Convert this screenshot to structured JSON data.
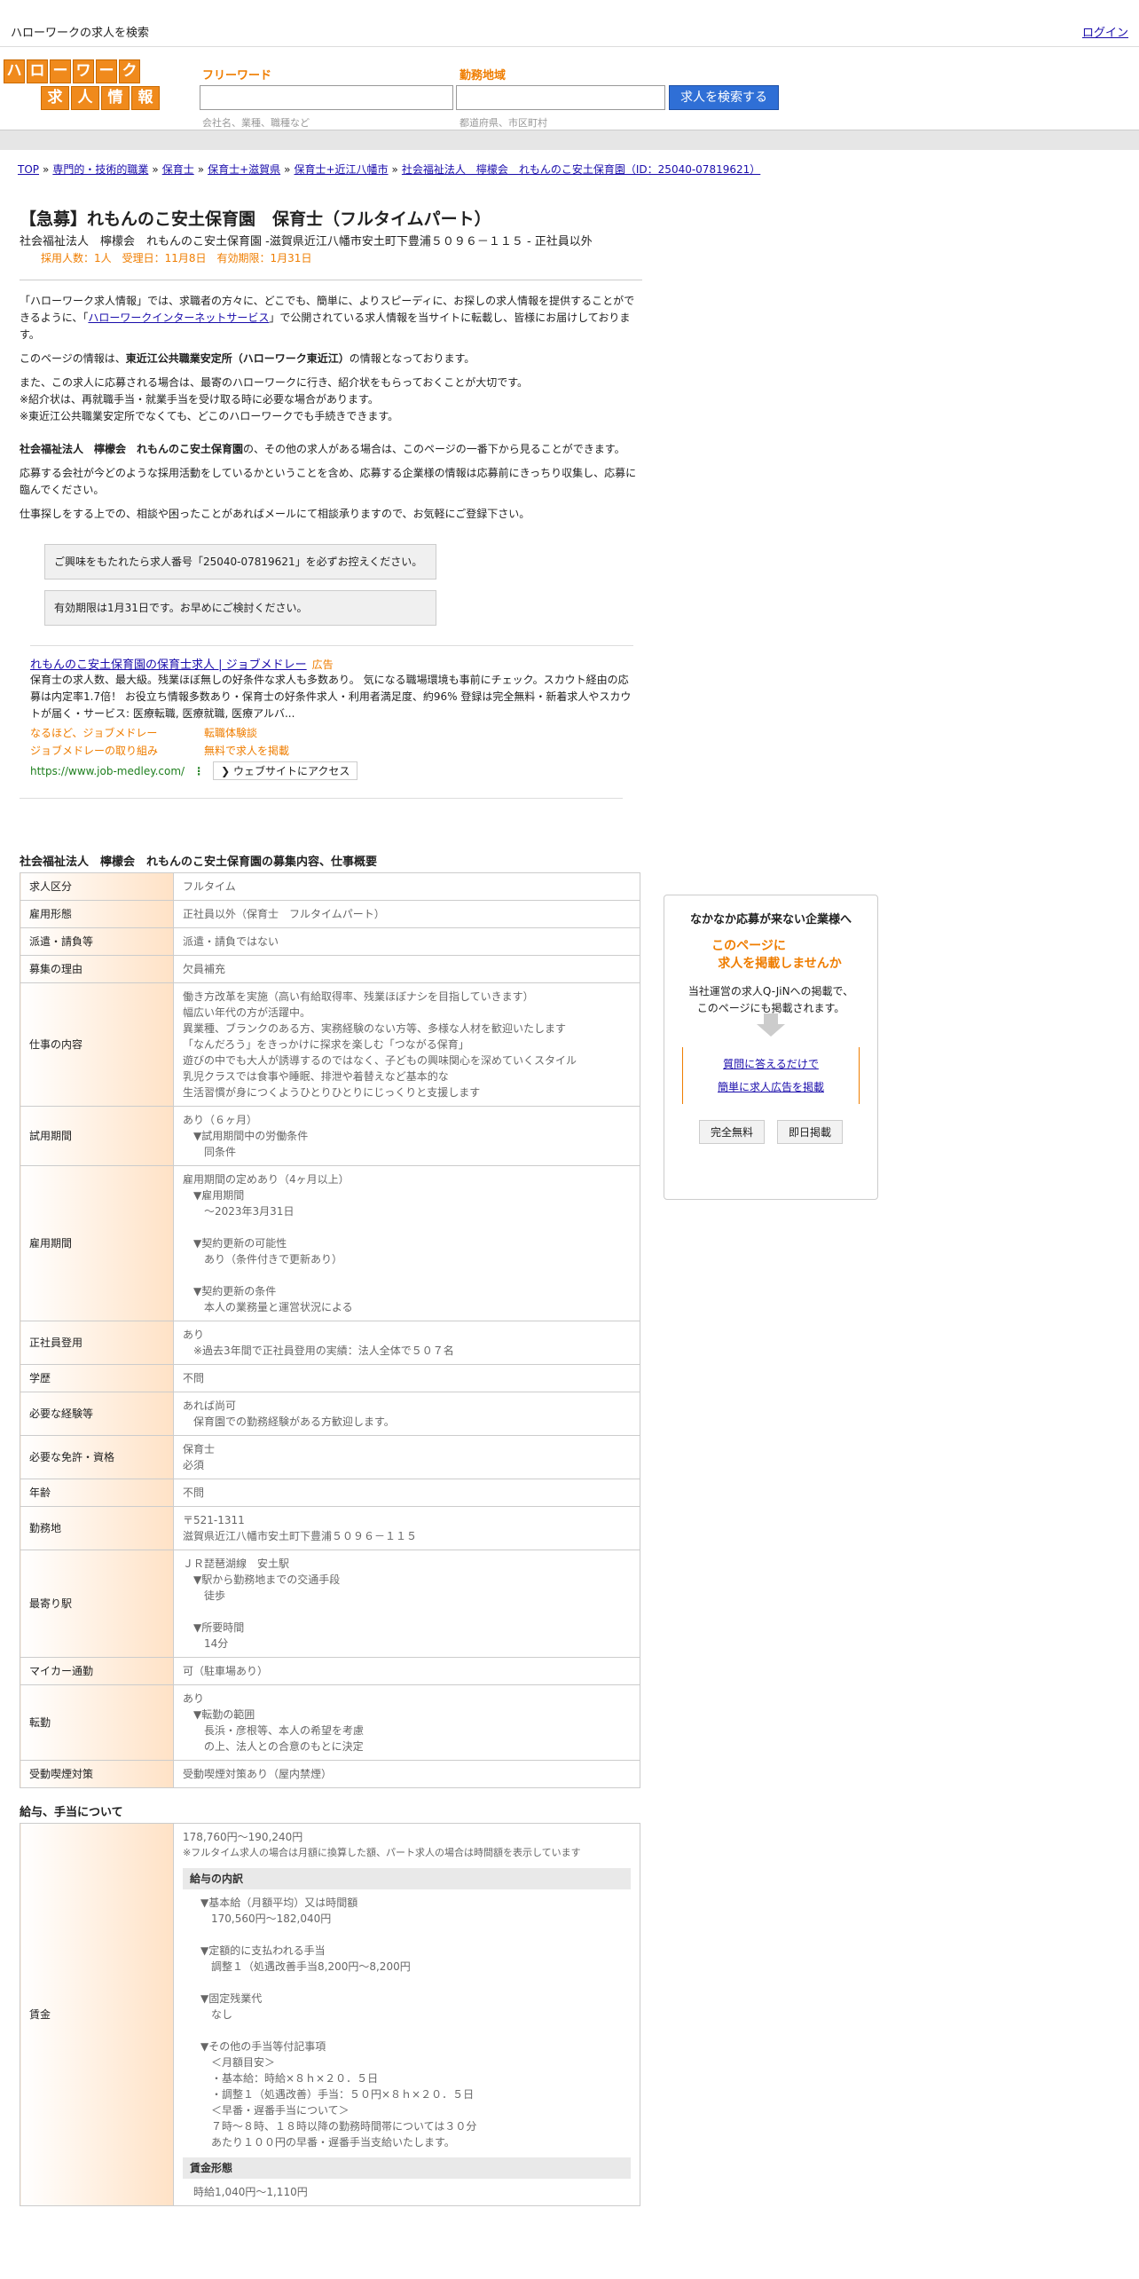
{
  "topbar": {
    "site_title": "ハローワークの求人を検索",
    "login": "ログイン"
  },
  "logo": {
    "row1": [
      "ハ",
      "ロ",
      "ー",
      "ワ",
      "ー",
      "ク"
    ],
    "row2": [
      "求",
      "人",
      "情",
      "報"
    ]
  },
  "search": {
    "freeword_label": "フリーワード",
    "freeword_hint": "会社名、業種、職種など",
    "area_label": "勤務地域",
    "area_hint": "都道府県、市区町村",
    "button": "求人を検索する"
  },
  "breadcrumb": [
    "TOP",
    "専門的・技術的職業",
    "保育士",
    "保育士+滋賀県",
    "保育士+近江八幡市",
    "社会福祉法人　檸檬会　れもんのこ安土保育園（ID：25040-07819621）"
  ],
  "job": {
    "title": "【急募】れもんのこ安土保育園　保育士（フルタイムパート）",
    "subtitle": "社会福祉法人　檸檬会　れもんのこ安土保育園 -滋賀県近江八幡市安土町下豊浦５０９６－１１５ - 正社員以外",
    "meta": "採用人数：1人　受理日：11月8日　有効期限：1月31日"
  },
  "intro": {
    "p1a": "「ハローワーク求人情報」では、求職者の方々に、どこでも、簡単に、よりスピーディに、お探しの求人情報を提供することができるように、「",
    "p1link": "ハローワークインターネットサービス",
    "p1b": "」で公開されている求人情報を当サイトに転載し、皆様にお届けしております。",
    "p2a": "このページの情報は、",
    "p2b": "東近江公共職業安定所（ハローワーク東近江）",
    "p2c": "の情報となっております。",
    "p3": [
      "また、この求人に応募される場合は、最寄のハローワークに行き、紹介状をもらっておくことが大切です。",
      "※紹介状は、再就職手当・就業手当を受け取る時に必要な場合があります。",
      "※東近江公共職業安定所でなくても、どこのハローワークでも手続きできます。"
    ],
    "p4a": "社会福祉法人　檸檬会　れもんのこ安土保育園",
    "p4b": "の、その他の求人がある場合は、このページの一番下から見ることができます。",
    "p5": "応募する会社が今どのような採用活動をしているかということを含め、応募する企業様の情報は応募前にきっちり収集し、応募に臨んでください。",
    "p6": "仕事探しをする上での、相談や困ったことがあればメールにて相談承りますので、お気軽にご登録下さい。",
    "note1": "ご興味をもたれたら求人番号「25040-07819621」を必ずお控えください。",
    "note2": "有効期限は1月31日です。お早めにご検討ください。"
  },
  "ad": {
    "title": "れもんのこ安土保育園の保育士求人 | ジョブメドレー",
    "badge": "広告",
    "body": "保育士の求人数、最大級。残業ほぼ無しの好条件な求人も多数あり。 気になる職場環境も事前にチェック。スカウト経由の応募は内定率1.7倍！ お役立ち情報多数あり・保育士の好条件求人・利用者満足度、約96% 登録は完全無料・新着求人やスカウトが届く・サービス: 医療転職, 医療就職, 医療アルバ...",
    "links": [
      "なるほど、ジョブメドレー",
      "転職体験談",
      "ジョブメドレーの取り組み",
      "無料で求人を掲載"
    ],
    "url": "https://www.job-medley.com/",
    "dots": "⋮",
    "visit": "❯ ウェブサイトにアクセス"
  },
  "details": {
    "title": "社会福祉法人　檸檬会　れもんのこ安土保育園の募集内容、仕事概要",
    "rows": [
      {
        "label": "求人区分",
        "lines": [
          "フルタイム"
        ]
      },
      {
        "label": "雇用形態",
        "lines": [
          "正社員以外（保育士　フルタイムパート）"
        ]
      },
      {
        "label": "派遣・請負等",
        "lines": [
          "派遣・請負ではない"
        ]
      },
      {
        "label": "募集の理由",
        "lines": [
          "欠員補充"
        ]
      },
      {
        "label": "仕事の内容",
        "lines": [
          "働き方改革を実施（高い有給取得率、残業ほぼナシを目指していきます）",
          "幅広い年代の方が活躍中。",
          "異業種、ブランクのある方、実務経験のない方等、多様な人材を歓迎いたします",
          "「なんだろう」をきっかけに探求を楽しむ「つながる保育」",
          "遊びの中でも大人が誘導するのではなく、子どもの興味関心を深めていくスタイル",
          "乳児クラスでは食事や睡眠、排泄や着替えなど基本的な",
          "生活習慣が身につくようひとりひとりにじっくりと支援します"
        ]
      },
      {
        "label": "試用期間",
        "lines": [
          "あり（６ヶ月）",
          "　▼試用期間中の労働条件",
          "　　同条件"
        ]
      },
      {
        "label": "雇用期間",
        "lines": [
          "雇用期間の定めあり（4ヶ月以上）",
          "　▼雇用期間",
          "　　〜2023年3月31日",
          "",
          "　▼契約更新の可能性",
          "　　あり（条件付きで更新あり）",
          "",
          "　▼契約更新の条件",
          "　　本人の業務量と運営状況による"
        ]
      },
      {
        "label": "正社員登用",
        "lines": [
          "あり",
          "　※過去3年間で正社員登用の実績：法人全体で５０７名"
        ]
      },
      {
        "label": "学歴",
        "lines": [
          "不問"
        ]
      },
      {
        "label": "必要な経験等",
        "lines": [
          "あれば尚可",
          "　保育園での勤務経験がある方歓迎します。"
        ]
      },
      {
        "label": "必要な免許・資格",
        "lines": [
          "保育士",
          "必須"
        ]
      },
      {
        "label": "年齢",
        "lines": [
          "不問"
        ]
      },
      {
        "label": "勤務地",
        "lines": [
          "〒521-1311",
          "滋賀県近江八幡市安土町下豊浦５０９６－１１５"
        ]
      },
      {
        "label": "最寄り駅",
        "lines": [
          "ＪＲ琵琶湖線　安土駅",
          "　▼駅から勤務地までの交通手段",
          "　　徒歩",
          "",
          "　▼所要時間",
          "　　14分"
        ]
      },
      {
        "label": "マイカー通勤",
        "lines": [
          "可（駐車場あり）"
        ]
      },
      {
        "label": "転勤",
        "lines": [
          "あり",
          "　▼転勤の範囲",
          "　　長浜・彦根等、本人の希望を考慮",
          "　　の上、法人との合意のもとに決定"
        ]
      },
      {
        "label": "受動喫煙対策",
        "lines": [
          "受動喫煙対策あり（屋内禁煙）"
        ]
      }
    ]
  },
  "salary": {
    "title": "給与、手当について",
    "label": "賃金",
    "range": "178,760円〜190,240円",
    "note": "※フルタイム求人の場合は月額に換算した額、パート求人の場合は時間額を表示しています",
    "breakdown_head": "給与の内訳",
    "breakdown": [
      "▼基本給（月額平均）又は時間額",
      "　170,560円〜182,040円",
      "",
      "▼定額的に支払われる手当",
      "　調整１（処遇改善手当8,200円〜8,200円",
      "",
      "▼固定残業代",
      "　なし",
      "",
      "▼その他の手当等付記事項",
      "　＜月額目安＞",
      "　・基本給：時給×８ｈ×２０．５日",
      "　・調整１（処遇改善）手当：５０円×８ｈ×２０．５日",
      "　＜早番・遅番手当について＞",
      "　７時～８時、１８時以降の勤務時間帯については３０分",
      "　あたり１００円の早番・遅番手当支給いたします。"
    ],
    "form_head": "賃金形態",
    "form": [
      "時給1,040円〜1,110円"
    ]
  },
  "sidebar": {
    "title": "なかなか応募が来ない企業様へ",
    "catch1": "このページに",
    "catch2": "求人を掲載しませんか",
    "text1": "当社運営の求人Q-JiNへの掲載で、",
    "text2": "このページにも掲載されます。",
    "link1": "質問に答えるだけで",
    "link2": "簡単に求人広告を掲載",
    "btn1": "完全無料",
    "btn2": "即日掲載"
  }
}
